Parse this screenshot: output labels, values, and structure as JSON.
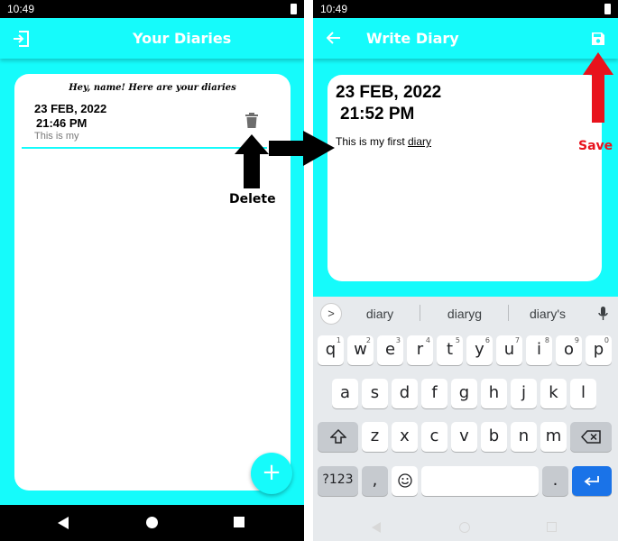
{
  "left_screen": {
    "status_time": "10:49",
    "app_title": "Your Diaries",
    "greeting": "Hey, name! Here are your diaries",
    "entry": {
      "date": "23 FEB, 2022",
      "time": "21:46 PM",
      "preview": "This is my"
    },
    "fab_icon": "plus-icon",
    "fab_label": "+",
    "appbar_icon": "logout-icon",
    "delete_icon": "trash-icon"
  },
  "right_screen": {
    "status_time": "10:49",
    "app_title": "Write Diary",
    "date": "23 FEB, 2022",
    "time": "21:52 PM",
    "body_text_prefix": "This is my first ",
    "body_text_word": "diary",
    "save_icon": "floppy-disk-icon",
    "back_icon": "arrow-left-icon"
  },
  "keyboard": {
    "suggestions": [
      "diary",
      "diaryg",
      "diary's"
    ],
    "row1": [
      {
        "key": "q",
        "num": "1"
      },
      {
        "key": "w",
        "num": "2"
      },
      {
        "key": "e",
        "num": "3"
      },
      {
        "key": "r",
        "num": "4"
      },
      {
        "key": "t",
        "num": "5"
      },
      {
        "key": "y",
        "num": "6"
      },
      {
        "key": "u",
        "num": "7"
      },
      {
        "key": "i",
        "num": "8"
      },
      {
        "key": "o",
        "num": "9"
      },
      {
        "key": "p",
        "num": "0"
      }
    ],
    "row2": [
      "a",
      "s",
      "d",
      "f",
      "g",
      "h",
      "j",
      "k",
      "l"
    ],
    "row3": [
      "z",
      "x",
      "c",
      "v",
      "b",
      "n",
      "m"
    ],
    "symbols_key": "?123",
    "comma_key": ",",
    "period_key": "."
  },
  "annotations": {
    "delete_label": "Delete",
    "save_label": "Save"
  },
  "colors": {
    "accent": "#15fbfb",
    "annotation_red": "#e8121c",
    "annotation_black": "#000000"
  }
}
